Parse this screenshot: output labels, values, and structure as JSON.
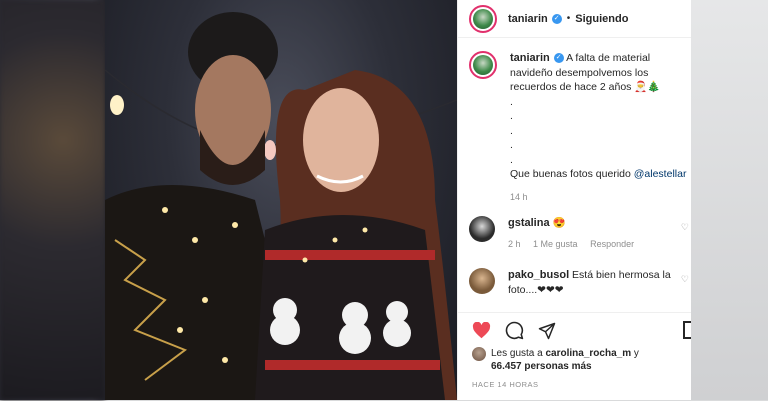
{
  "post": {
    "username": "taniarin",
    "following_label": "Siguiendo",
    "caption_text": "A falta de material navideño desempolvemos los recuerdos de hace 2 años 🎅🎄",
    "caption_dots": [
      ".",
      ".",
      ".",
      ".",
      "."
    ],
    "caption_closing": "Que buenas fotos querido ",
    "caption_mention": "@alestellar",
    "time_ago": "14 h"
  },
  "comments": [
    {
      "username": "gstalina",
      "text": "😍",
      "time": "2 h",
      "likes": "1 Me gusta",
      "reply": "Responder"
    },
    {
      "username": "pako_busol",
      "text": "Está bien hermosa la foto....❤❤❤"
    }
  ],
  "likes": {
    "prefix": "Les gusta a ",
    "user": "carolina_rocha_m",
    "joiner": " y",
    "count": "66.457 personas más"
  },
  "posted_label": "HACE 14 HORAS",
  "icons": [
    "heart-icon",
    "comment-icon",
    "share-icon",
    "bookmark-icon",
    "verified-icon"
  ],
  "colors": {
    "like": "#ed4956",
    "verified": "#3897f0",
    "link": "#00376b"
  }
}
